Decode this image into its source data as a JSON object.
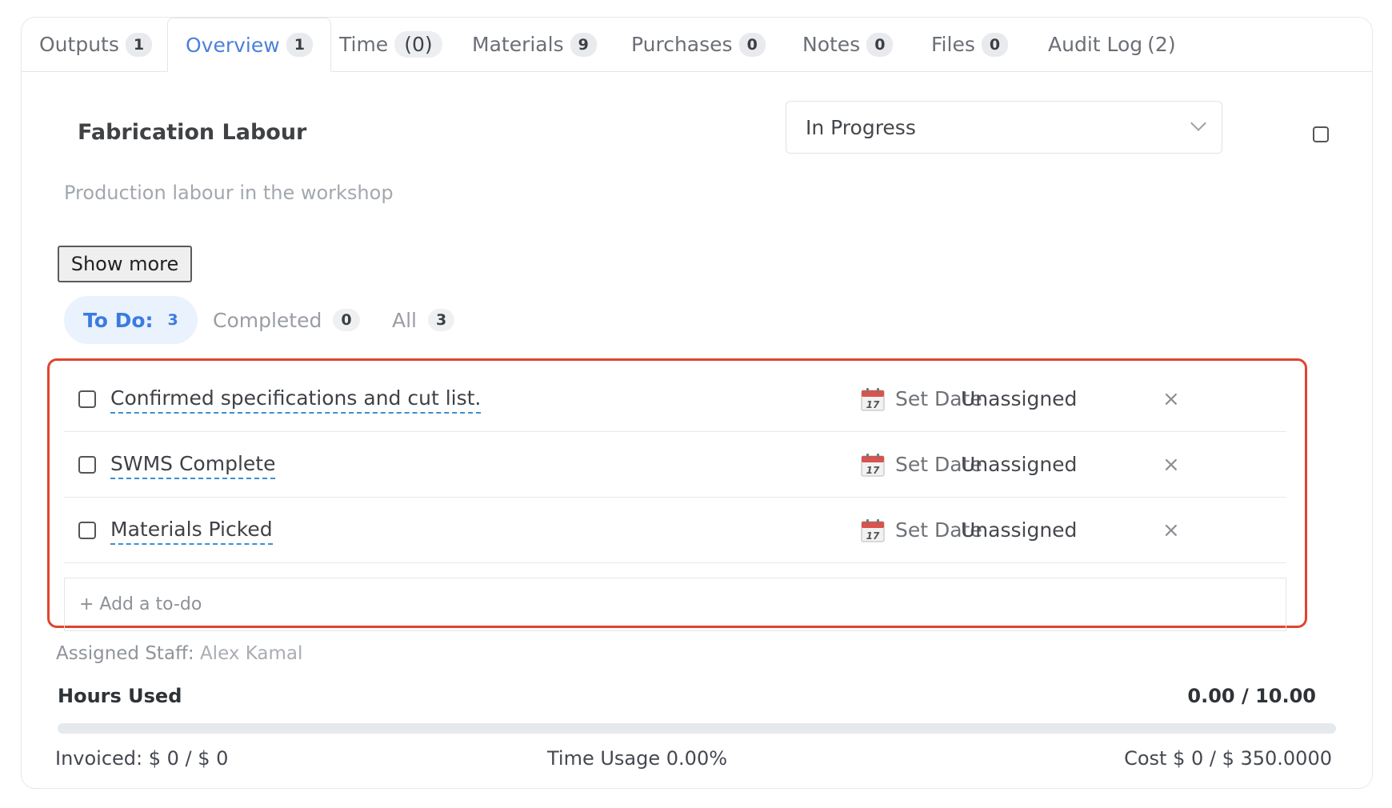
{
  "tabs": [
    {
      "label": "Outputs",
      "count": "1"
    },
    {
      "label": "Overview",
      "count": "1"
    },
    {
      "label": "Time",
      "count": "(0)"
    },
    {
      "label": "Materials",
      "count": "9"
    },
    {
      "label": "Purchases",
      "count": "0"
    },
    {
      "label": "Notes",
      "count": "0"
    },
    {
      "label": "Files",
      "count": "0"
    },
    {
      "label": "Audit Log",
      "count": "(2)"
    }
  ],
  "task": {
    "title": "Fabrication Labour",
    "status": "In Progress",
    "description": "Production labour in the workshop",
    "show_more_label": "Show more"
  },
  "filters": [
    {
      "label": "To Do:",
      "count": "3"
    },
    {
      "label": "Completed",
      "count": "0"
    },
    {
      "label": "All",
      "count": "3"
    }
  ],
  "todos": [
    {
      "text": "Confirmed specifications and cut list.",
      "date_label": "Set Date",
      "assignee": "Unassigned",
      "remove": "×"
    },
    {
      "text": "SWMS Complete",
      "date_label": "Set Date",
      "assignee": "Unassigned",
      "remove": "×"
    },
    {
      "text": "Materials Picked",
      "date_label": "Set Date",
      "assignee": "Unassigned",
      "remove": "×"
    }
  ],
  "add_todo_placeholder": "+ Add a to-do",
  "assigned_staff": {
    "label": "Assigned Staff:",
    "name": "Alex Kamal"
  },
  "hours": {
    "label": "Hours Used",
    "value": "0.00 / 10.00",
    "progress": 0
  },
  "footer": {
    "invoiced": "Invoiced: $ 0 / $ 0",
    "time_usage": "Time Usage 0.00%",
    "cost": "Cost $ 0 / $ 350.0000"
  },
  "colors": {
    "accent": "#4d80d8",
    "highlight_border": "#e0442f",
    "calendar_red": "#d9534f"
  },
  "calendar_day": "17"
}
